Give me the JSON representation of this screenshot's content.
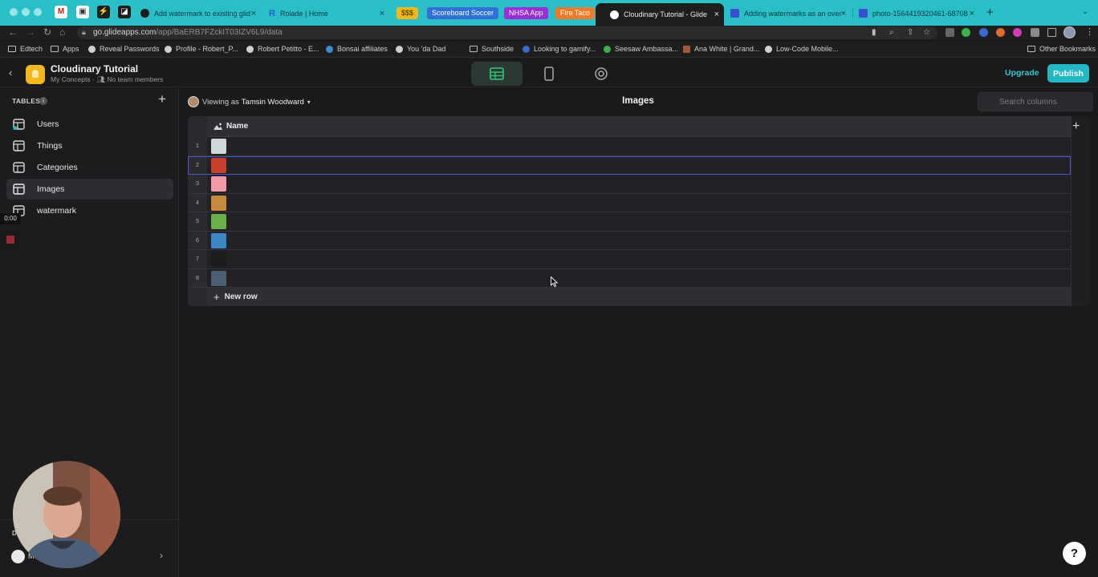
{
  "browser": {
    "tabs": [
      {
        "title": "Add watermark to existing glid",
        "active": false
      },
      {
        "title": "Rolade | Home",
        "active": false
      },
      {
        "title": "Cloudinary Tutorial - Glide",
        "active": true
      },
      {
        "title": "Adding watermarks as an over",
        "active": false
      },
      {
        "title": "photo-1564419320461-68708",
        "active": false
      }
    ],
    "tab_chips": [
      {
        "label": "$$$",
        "bg": "#f0b81a",
        "fg": "#3a2a00"
      },
      {
        "label": "Scoreboard Soccer",
        "bg": "#2f6fd6",
        "fg": "#ffffff"
      },
      {
        "label": "NHSA App",
        "bg": "#9a2fd6",
        "fg": "#ffffff"
      },
      {
        "label": "Fire Taco",
        "bg": "#f07a2a",
        "fg": "#ffffff"
      }
    ],
    "url": {
      "domain": "go.glideapps.com",
      "path": "/app/BaERB7FZckIT03IZV6L9/data"
    },
    "bookmarks": [
      "Edtech",
      "Apps",
      "Reveal Passwords",
      "Profile - Robert_P...",
      "Robert Petitto - E...",
      "Bonsai affiliates",
      "You 'da Dad",
      "Southside",
      "Looking to gamify...",
      "Seesaw Ambassa...",
      "Ana White | Grand...",
      "Low-Code Mobile..."
    ],
    "other_bookmarks": "Other Bookmarks"
  },
  "app": {
    "title": "Cloudinary Tutorial",
    "org": "My Concepts",
    "members": "No team members",
    "upgrade": "Upgrade",
    "publish": "Publish",
    "accent": "#22b9c4"
  },
  "sidebar": {
    "tables_label": "TABLES",
    "items": [
      {
        "label": "Users",
        "selected": false
      },
      {
        "label": "Things",
        "selected": false
      },
      {
        "label": "Categories",
        "selected": false
      },
      {
        "label": "Images",
        "selected": true
      },
      {
        "label": "watermark",
        "selected": false
      }
    ],
    "timer": "0:00",
    "footer_initial": "D",
    "footer_user": "M"
  },
  "main": {
    "viewing_prefix": "Viewing as",
    "viewing_user": "Tamsin Woodward",
    "title": "Images",
    "search_placeholder": "Search columns",
    "column_header": "Name",
    "rows": [
      {
        "n": "1",
        "thumb": "#cfd6dc",
        "selected": false
      },
      {
        "n": "2",
        "thumb": "#c9402a",
        "selected": true
      },
      {
        "n": "3",
        "thumb": "#f29aa8",
        "selected": false
      },
      {
        "n": "4",
        "thumb": "#c58a3c",
        "selected": false
      },
      {
        "n": "5",
        "thumb": "#6ab04a",
        "selected": false
      },
      {
        "n": "6",
        "thumb": "#3c86c4",
        "selected": false
      },
      {
        "n": "7",
        "thumb": "#1c1c1c",
        "selected": false
      },
      {
        "n": "8",
        "thumb": "#4a5f74",
        "selected": false
      }
    ],
    "new_row": "New row"
  },
  "help": "?"
}
